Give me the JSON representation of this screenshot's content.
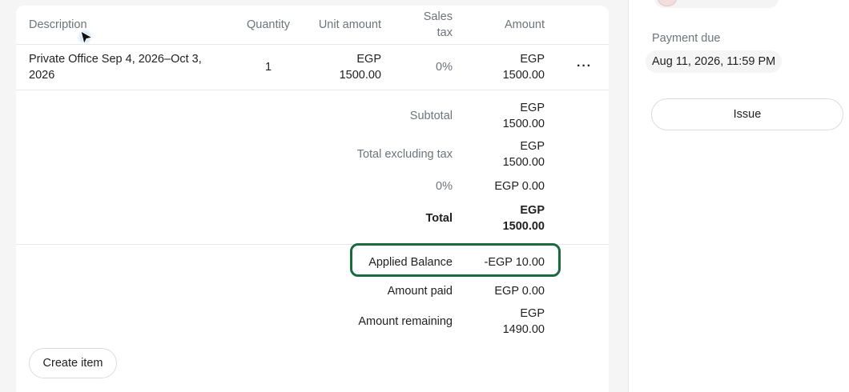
{
  "table": {
    "headers": {
      "description": "Description",
      "quantity": "Quantity",
      "unit_amount": "Unit amount",
      "sales_tax_line1": "Sales",
      "sales_tax_line2": "tax",
      "amount": "Amount"
    },
    "row": {
      "description_line1": "Private Office Sep 4, 2026–Oct 3,",
      "description_line2": "2026",
      "quantity": "1",
      "unit_amount_line1": "EGP",
      "unit_amount_line2": "1500.00",
      "sales_tax": "0%",
      "amount_line1": "EGP",
      "amount_line2": "1500.00",
      "menu_icon": "more-horizontal-icon"
    }
  },
  "summary": {
    "subtotal_label": "Subtotal",
    "subtotal_line1": "EGP",
    "subtotal_line2": "1500.00",
    "total_excl_tax_label": "Total excluding tax",
    "total_excl_tax_line1": "EGP",
    "total_excl_tax_line2": "1500.00",
    "tax_label": "0%",
    "tax_value": "EGP 0.00",
    "total_label": "Total",
    "total_line1": "EGP",
    "total_line2": "1500.00",
    "applied_balance_label": "Applied Balance",
    "applied_balance_value": "-EGP 10.00",
    "amount_paid_label": "Amount paid",
    "amount_paid_value": "EGP 0.00",
    "amount_remaining_label": "Amount remaining",
    "amount_remaining_line1": "EGP",
    "amount_remaining_line2": "1490.00"
  },
  "actions": {
    "create_item": "Create item"
  },
  "sidebar": {
    "payment_due_label": "Payment due",
    "payment_due_value": "Aug 11, 2026, 11:59 PM",
    "issue_button": "Issue"
  },
  "colors": {
    "highlight_border": "#1a6a40",
    "muted_text": "#6e7479"
  }
}
